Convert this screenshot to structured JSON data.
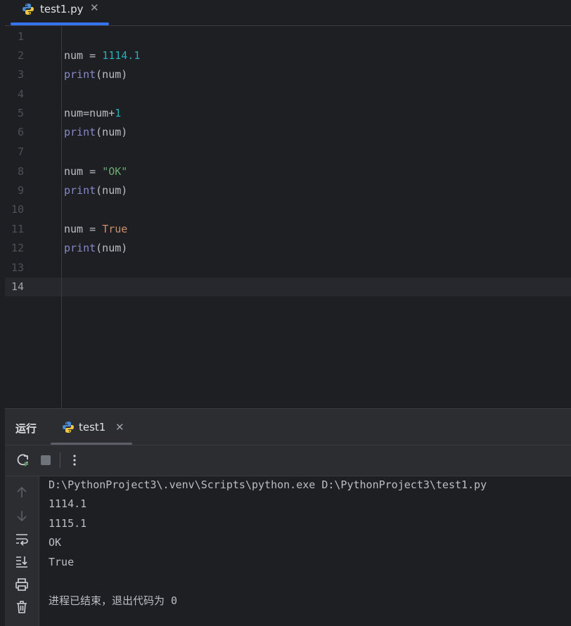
{
  "editor_tab": {
    "filename": "test1.py"
  },
  "code_lines": [
    {
      "n": "1"
    },
    {
      "n": "2",
      "a": "num = ",
      "b": "1114.1"
    },
    {
      "n": "3",
      "a": "print",
      "b": "(num)"
    },
    {
      "n": "4"
    },
    {
      "n": "5",
      "a": "num=num+",
      "b": "1"
    },
    {
      "n": "6",
      "a": "print",
      "b": "(num)"
    },
    {
      "n": "7"
    },
    {
      "n": "8",
      "a": "num = ",
      "b": "\"OK\""
    },
    {
      "n": "9",
      "a": "print",
      "b": "(num)"
    },
    {
      "n": "10"
    },
    {
      "n": "11",
      "a": "num = ",
      "b": "True"
    },
    {
      "n": "12",
      "a": "print",
      "b": "(num)"
    },
    {
      "n": "13"
    },
    {
      "n": "14"
    }
  ],
  "run_panel": {
    "title": "运行",
    "tab_label": "test1"
  },
  "console": {
    "lines": [
      "D:\\PythonProject3\\.venv\\Scripts\\python.exe D:\\PythonProject3\\test1.py",
      "1114.1",
      "1115.1",
      "OK",
      "True",
      "",
      "进程已结束，退出代码为 0"
    ]
  },
  "colors": {
    "accent": "#3574f0",
    "number": "#2aacb8",
    "string": "#6aab73",
    "keyword": "#cf8e6d",
    "builtin": "#8888c6"
  },
  "icons": [
    "python-file-icon",
    "close-icon",
    "rerun-icon",
    "stop-icon",
    "more-icon",
    "up-arrow-icon",
    "down-arrow-icon",
    "soft-wrap-icon",
    "scroll-to-end-icon",
    "print-icon",
    "trash-icon"
  ]
}
